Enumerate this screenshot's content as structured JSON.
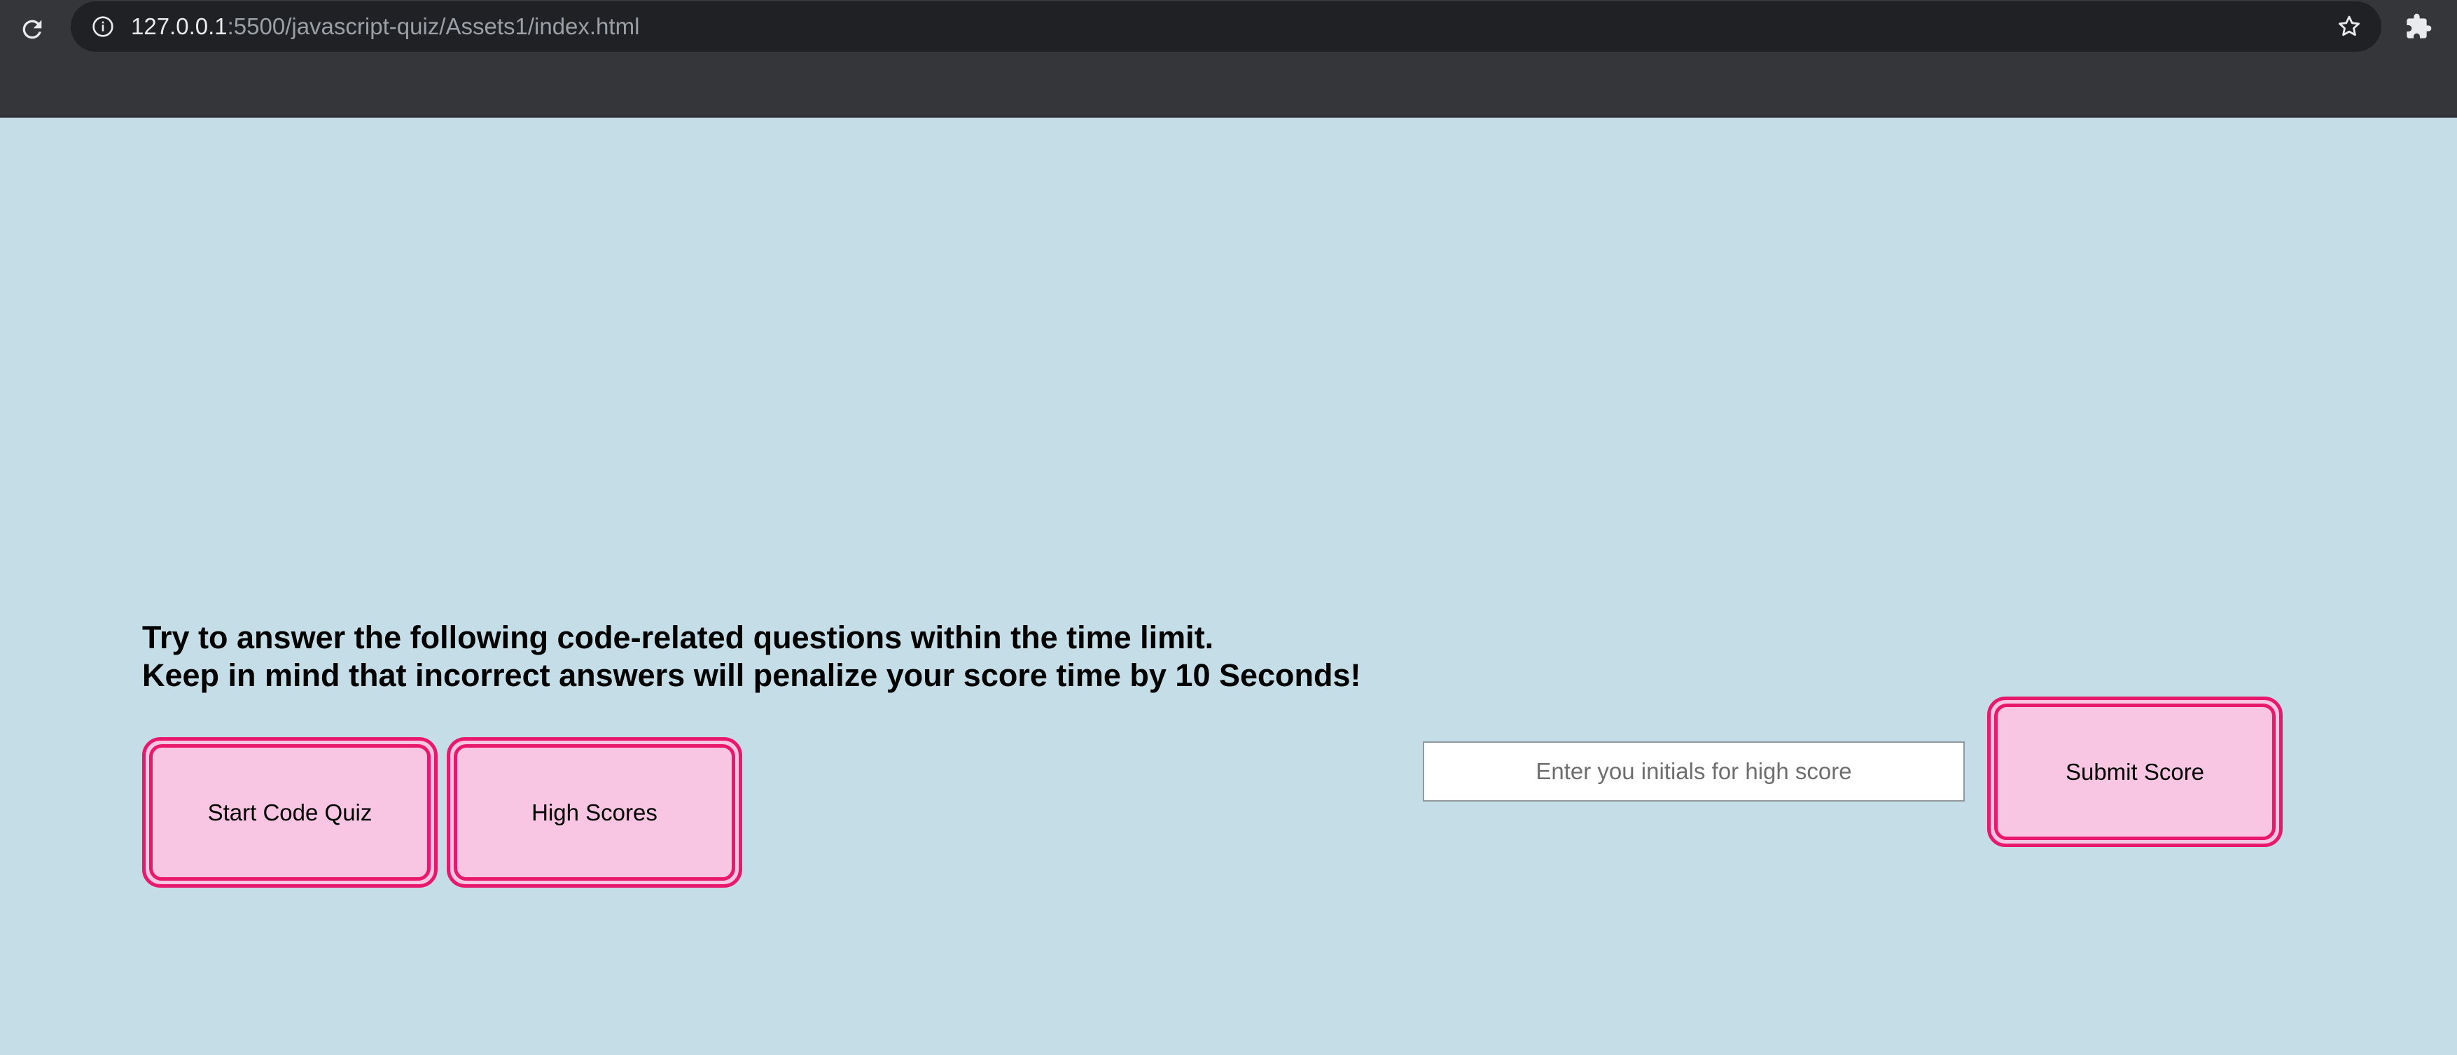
{
  "browser": {
    "url_host": "127.0.0.1",
    "url_rest": ":5500/javascript-quiz/Assets1/index.html",
    "icons": [
      "reload-icon",
      "info-icon",
      "star-icon",
      "extensions-icon"
    ]
  },
  "page": {
    "intro_line1": "Try to answer the following code-related questions within the time limit.",
    "intro_line2": "Keep in mind that incorrect answers will penalize your score time by 10 Seconds!",
    "start_button": "Start Code Quiz",
    "highscores_button": "High Scores",
    "initials_placeholder": "Enter you initials for high score",
    "initials_value": "",
    "submit_button": "Submit Score"
  },
  "colors": {
    "page_background": "#c4dde7",
    "button_fill": "#f8c5e2",
    "button_border": "#e8196c",
    "chrome_dark": "#35363a",
    "omnibox": "#202124"
  }
}
